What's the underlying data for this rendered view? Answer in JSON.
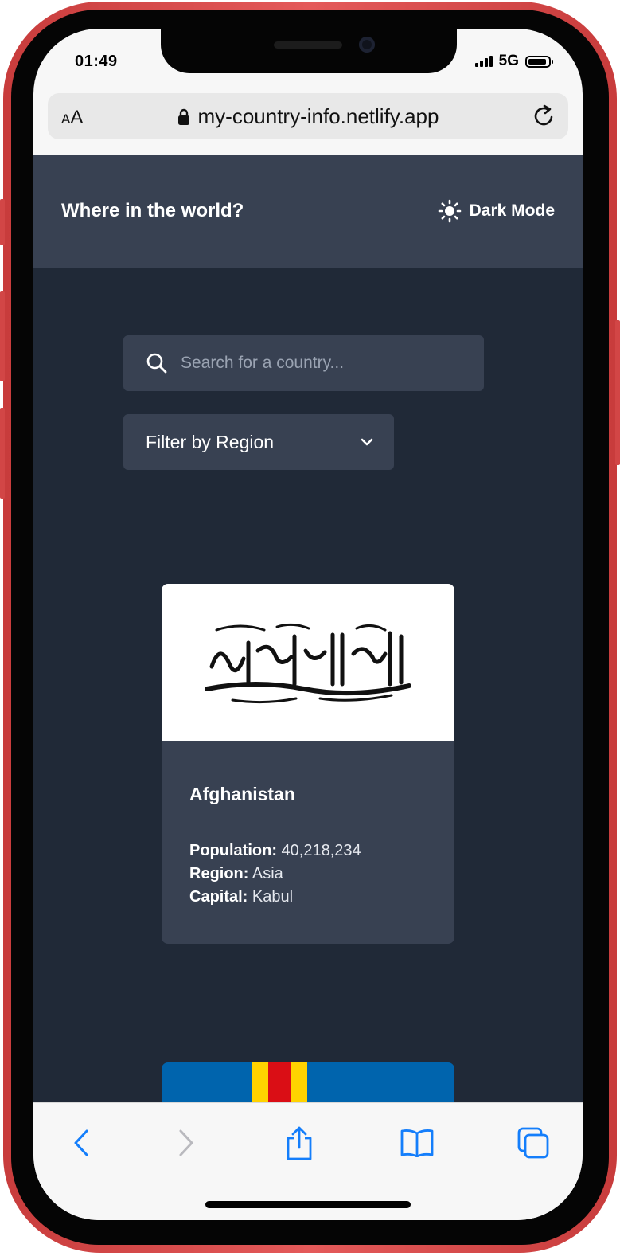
{
  "status_bar": {
    "time": "01:49",
    "network": "5G",
    "battery_level": 0.9
  },
  "browser": {
    "text_size_label_small": "A",
    "text_size_label_large": "A",
    "url": "my-country-info.netlify.app"
  },
  "header": {
    "title": "Where in the world?",
    "theme_toggle_label": "Dark Mode"
  },
  "search": {
    "placeholder": "Search for a country..."
  },
  "filter": {
    "label": "Filter by Region"
  },
  "countries": [
    {
      "name": "Afghanistan",
      "population_label": "Population:",
      "population": "40,218,234",
      "region_label": "Region:",
      "region": "Asia",
      "capital_label": "Capital:",
      "capital": "Kabul"
    }
  ],
  "colors": {
    "background": "#202937",
    "surface": "#384152",
    "text": "#ffffff",
    "phone_frame": "#d24646",
    "browser_accent": "#147efb",
    "flag_aland_blue": "#0064ad",
    "flag_aland_yellow": "#ffd300",
    "flag_aland_red": "#da0e15"
  },
  "icons": {
    "search": "search-icon",
    "theme_toggle": "sun-icon",
    "dropdown": "chevron-down-icon",
    "secure": "lock-icon",
    "reload": "reload-icon",
    "toolbar": [
      "back-icon",
      "forward-icon",
      "share-icon",
      "bookmarks-icon",
      "tabs-icon"
    ]
  }
}
